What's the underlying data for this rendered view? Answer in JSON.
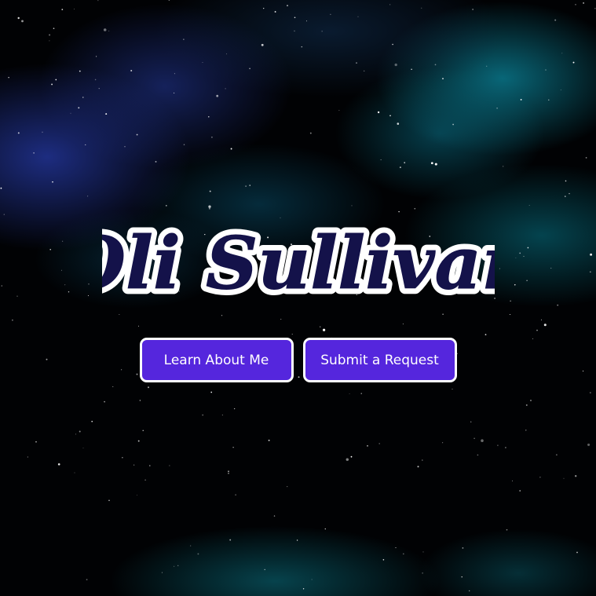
{
  "hero": {
    "name": "Oli Sullivan"
  },
  "buttons": {
    "learn_label": "Learn About Me",
    "request_label": "Submit a Request"
  },
  "colors": {
    "button_fill": "#5526dd",
    "button_border": "#ffffff",
    "logo_fill": "#14124a",
    "logo_outline": "#ffffff",
    "nebula_blue": "#223496",
    "nebula_teal": "#0a7a8c"
  }
}
